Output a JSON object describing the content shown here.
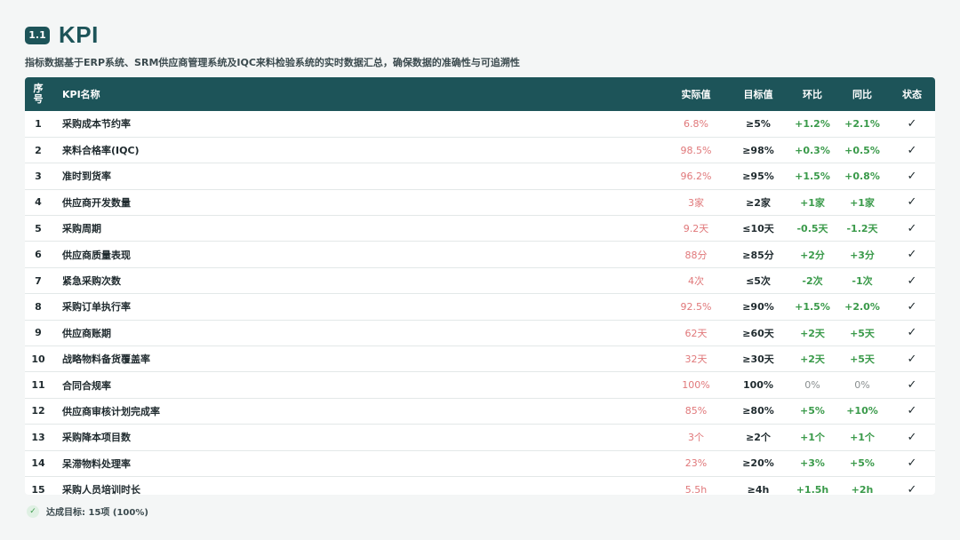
{
  "header": {
    "badge": "1.1",
    "title": "KPI",
    "subtitle": "指标数据基于ERP系统、SRM供应商管理系统及IQC来料检验系统的实时数据汇总，确保数据的准确性与可追溯性"
  },
  "table": {
    "columns": {
      "seq": "序号",
      "name": "KPI名称",
      "actual": "实际值",
      "target": "目标值",
      "mom": "环比",
      "yoy": "同比",
      "status": "状态"
    },
    "rows": [
      {
        "seq": "1",
        "name": "采购成本节约率",
        "actual": "6.8%",
        "target": "≥5%",
        "mom": "+1.2%",
        "yoy": "+2.1%",
        "status": "✓"
      },
      {
        "seq": "2",
        "name": "来料合格率(IQC)",
        "actual": "98.5%",
        "target": "≥98%",
        "mom": "+0.3%",
        "yoy": "+0.5%",
        "status": "✓"
      },
      {
        "seq": "3",
        "name": "准时到货率",
        "actual": "96.2%",
        "target": "≥95%",
        "mom": "+1.5%",
        "yoy": "+0.8%",
        "status": "✓"
      },
      {
        "seq": "4",
        "name": "供应商开发数量",
        "actual": "3家",
        "target": "≥2家",
        "mom": "+1家",
        "yoy": "+1家",
        "status": "✓"
      },
      {
        "seq": "5",
        "name": "采购周期",
        "actual": "9.2天",
        "target": "≤10天",
        "mom": "-0.5天",
        "yoy": "-1.2天",
        "status": "✓"
      },
      {
        "seq": "6",
        "name": "供应商质量表现",
        "actual": "88分",
        "target": "≥85分",
        "mom": "+2分",
        "yoy": "+3分",
        "status": "✓"
      },
      {
        "seq": "7",
        "name": "紧急采购次数",
        "actual": "4次",
        "target": "≤5次",
        "mom": "-2次",
        "yoy": "-1次",
        "status": "✓"
      },
      {
        "seq": "8",
        "name": "采购订单执行率",
        "actual": "92.5%",
        "target": "≥90%",
        "mom": "+1.5%",
        "yoy": "+2.0%",
        "status": "✓"
      },
      {
        "seq": "9",
        "name": "供应商账期",
        "actual": "62天",
        "target": "≥60天",
        "mom": "+2天",
        "yoy": "+5天",
        "status": "✓"
      },
      {
        "seq": "10",
        "name": "战略物料备货覆盖率",
        "actual": "32天",
        "target": "≥30天",
        "mom": "+2天",
        "yoy": "+5天",
        "status": "✓"
      },
      {
        "seq": "11",
        "name": "合同合规率",
        "actual": "100%",
        "target": "100%",
        "mom": "0%",
        "yoy": "0%",
        "status": "✓"
      },
      {
        "seq": "12",
        "name": "供应商审核计划完成率",
        "actual": "85%",
        "target": "≥80%",
        "mom": "+5%",
        "yoy": "+10%",
        "status": "✓"
      },
      {
        "seq": "13",
        "name": "采购降本项目数",
        "actual": "3个",
        "target": "≥2个",
        "mom": "+1个",
        "yoy": "+1个",
        "status": "✓"
      },
      {
        "seq": "14",
        "name": "呆滞物料处理率",
        "actual": "23%",
        "target": "≥20%",
        "mom": "+3%",
        "yoy": "+5%",
        "status": "✓"
      },
      {
        "seq": "15",
        "name": "采购人员培训时长",
        "actual": "5.5h",
        "target": "≥4h",
        "mom": "+1.5h",
        "yoy": "+2h",
        "status": "✓"
      }
    ]
  },
  "footer": {
    "icon": "check-circle-icon",
    "text": "达成目标: 15项 (100%)"
  },
  "colors": {
    "brand": "#1d5459",
    "actual": "#e0787a",
    "positive": "#3a9a4a",
    "neutral": "#8a8f90"
  }
}
